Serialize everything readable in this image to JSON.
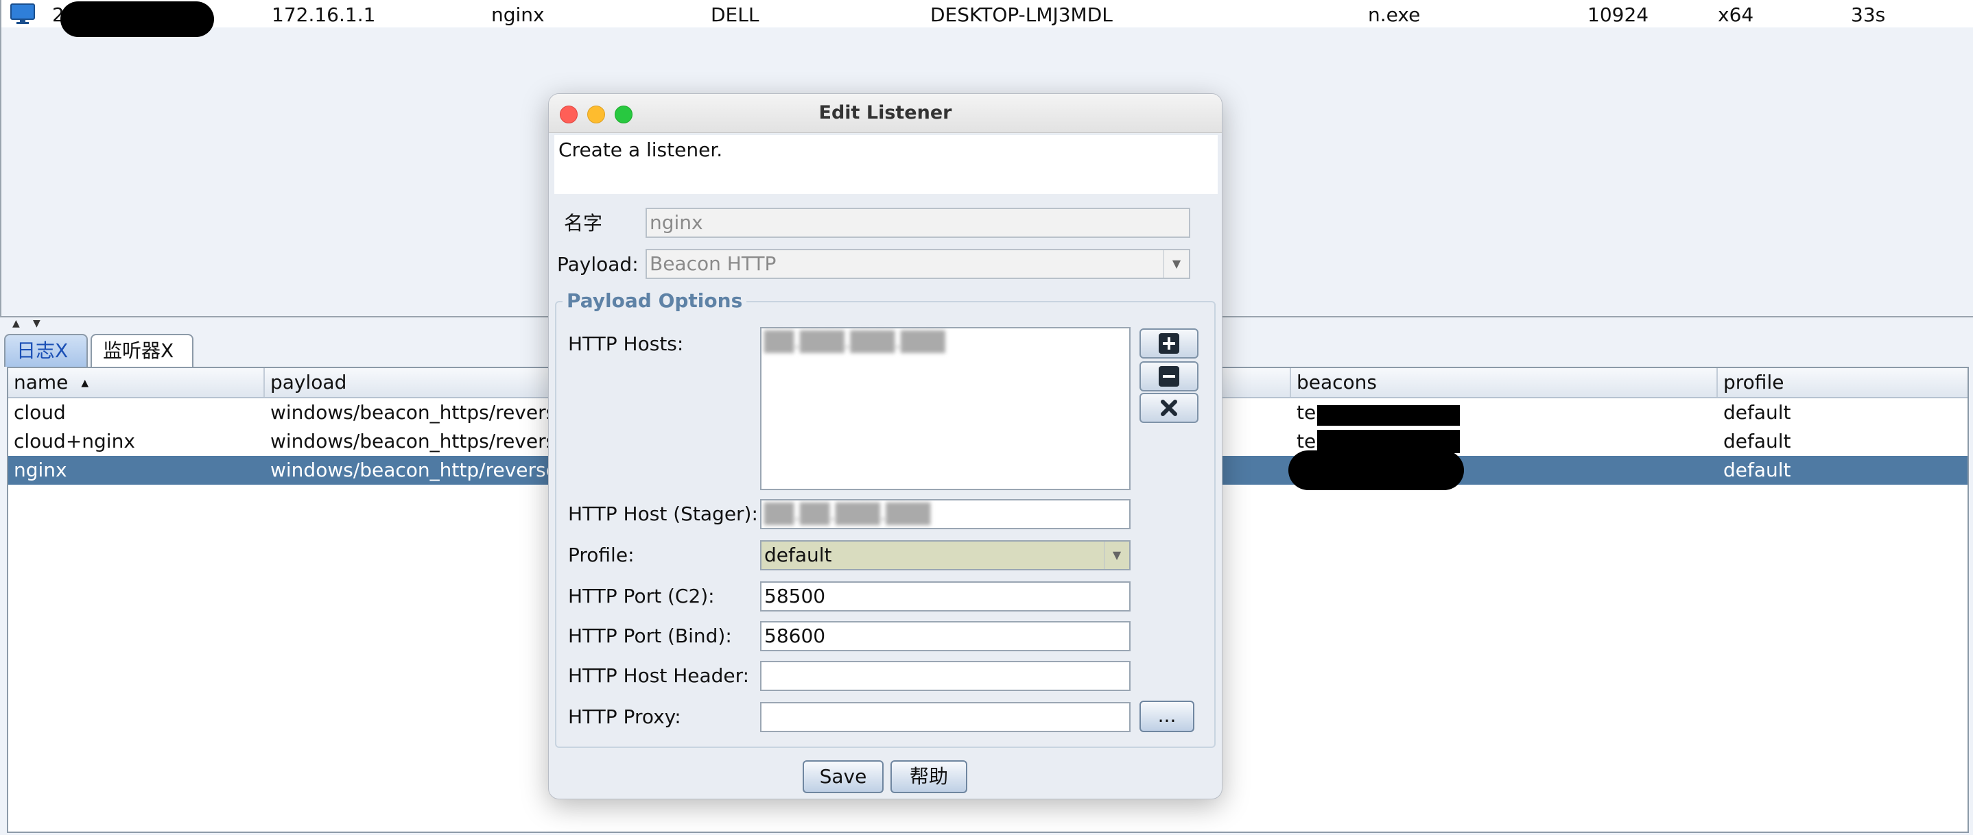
{
  "session_row": {
    "id_visible": "2",
    "ip": "172.16.1.1",
    "listener": "nginx",
    "user": "DELL",
    "computer": "DESKTOP-LMJ3MDL",
    "process": "n.exe",
    "pid": "10924",
    "arch": "x64",
    "last": "33s"
  },
  "tabs": [
    {
      "label": "日志X"
    },
    {
      "label": "监听器X"
    }
  ],
  "listener_table": {
    "headers": [
      "name",
      "payload",
      "beacons",
      "profile"
    ],
    "sort_indicator": "▲",
    "rows": [
      {
        "name": "cloud",
        "payload": "windows/beacon_https/revers",
        "beacons": "tes",
        "profile": "default"
      },
      {
        "name": "cloud+nginx",
        "payload": "windows/beacon_https/revers",
        "beacons": "tes",
        "profile": "default"
      },
      {
        "name": "nginx",
        "payload": "windows/beacon_http/reverse",
        "beacons": "",
        "profile": "default"
      }
    ]
  },
  "dialog": {
    "title": "Edit Listener",
    "description": "Create a listener.",
    "name_label": "名字",
    "name_value": "nginx",
    "payload_label": "Payload:",
    "payload_value": "Beacon HTTP",
    "options_title": "Payload Options",
    "http_hosts_label": "HTTP Hosts:",
    "http_hosts_value": "██.███.███.███",
    "stager_label": "HTTP Host (Stager):",
    "stager_value": "██.██.███.███",
    "profile_label": "Profile:",
    "profile_value": "default",
    "port_c2_label": "HTTP Port (C2):",
    "port_c2_value": "58500",
    "port_bind_label": "HTTP Port (Bind):",
    "port_bind_value": "58600",
    "host_header_label": "HTTP Host Header:",
    "host_header_value": "",
    "proxy_label": "HTTP Proxy:",
    "proxy_value": "",
    "proxy_button": "...",
    "save_button": "Save",
    "help_button": "帮助"
  },
  "colors": {
    "selected_row": "#4f7aa3",
    "group_title": "#5e82a6",
    "profile_combo_bg": "#d9dcbf"
  }
}
